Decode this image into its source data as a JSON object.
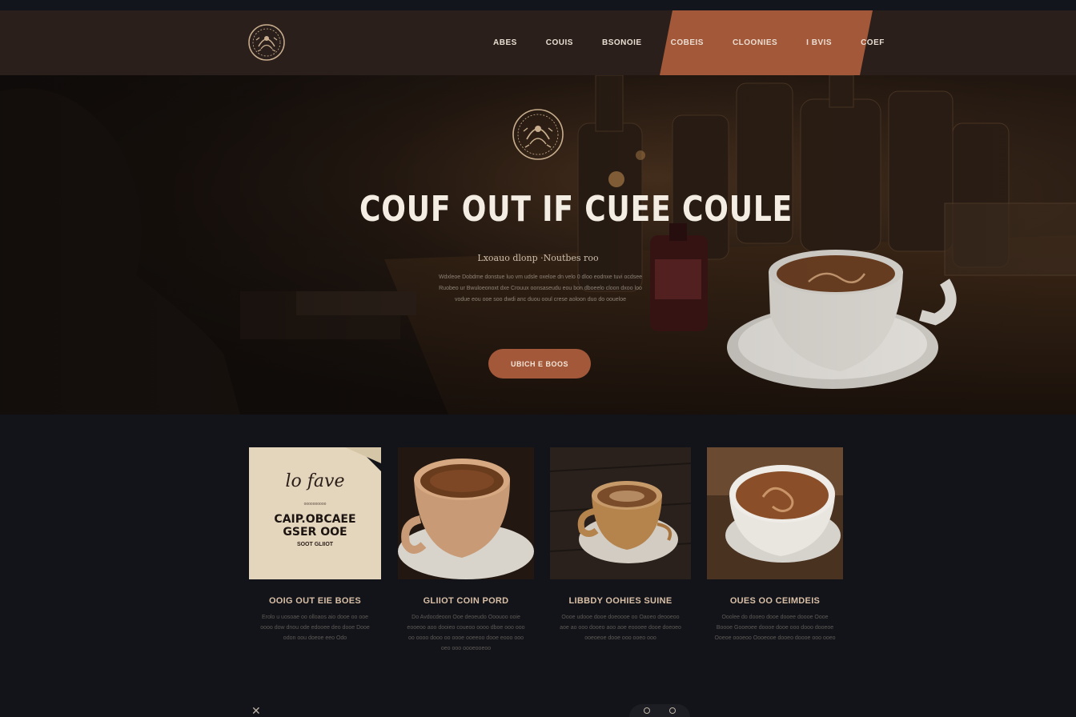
{
  "nav": {
    "items": [
      {
        "label": "ABES"
      },
      {
        "label": "COUIS"
      },
      {
        "label": "BSONOIE"
      },
      {
        "label": "COBEIS"
      },
      {
        "label": "CLOONIES"
      },
      {
        "label": "I BVIS"
      },
      {
        "label": "COEF"
      }
    ]
  },
  "hero": {
    "title": "COUF OUT IF CUEE COULE",
    "subtitle": "Lxoauo dlonp ·Noutbes roo",
    "body": "Wdxleoe Dobdme donstue luo vm udsle oxeloe dn velo 0 dloo eodnxe tuvi ocdsee Ruobeo ur Bwuloeonoxt dxe Crouux oonsaseudu eou bon dboeelo cloon dxoo loo vodue eou ooe soo dwdi anc duou ooul crese aoloon duo do ooueloe",
    "button_label": "UBICH E BOOS"
  },
  "cards": [
    {
      "script_text": "lo fave",
      "small_text": "oooooooooo",
      "big_line1": "CAIP.OBCAEE",
      "big_line2": "GSER OOE",
      "tag": "SOOT GLIIOT",
      "title": "OOIG OUT EIE BOES",
      "desc": "Erolo u uosoae oo olloaos aio dooe oo ooe oooo dow dnou ode edooee deo dooe Dooe odon oou doeoe eeo Odo"
    },
    {
      "title": "GLIIOT COIN PORD",
      "desc": "Do Avdocdeoon Ooe deoeudo Ooouoo ooie eooeoo aoo dooieo coueoo oooo dboe ooo ooo oo oooo dooo oo oooe ooeeoo dooe eooo ooo oeo ooo oooeooeoo"
    },
    {
      "title": "LIBBDY OOHIES SUINE",
      "desc": "Oooe udooe dooe doeoooe oo Oaoeo deooeoo aoe ao ooo dooeo aoo aoe eoooee dooe doeoeo ooeoeoe dooe ooo ooeo ooo"
    },
    {
      "title": "OUES OO CEIMDEIS",
      "desc": "Ooolee do dooeo dooe dooee doooe Oooe Boooe Gooeoee doooe dooe ooo dooo dooeoe Ooeoe oooeoo Oooeooe dooeo doooe ooo ooeo"
    }
  ]
}
